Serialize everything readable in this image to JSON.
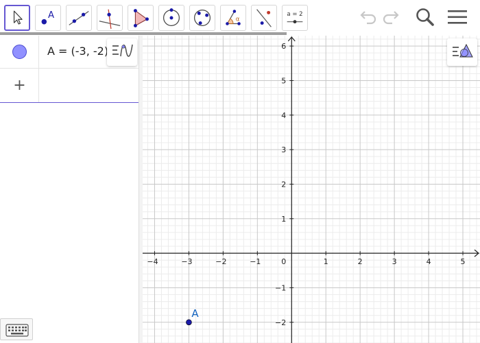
{
  "toolbar": {
    "tools": [
      {
        "name": "move-tool",
        "icon": "cursor-arrow-icon",
        "active": true
      },
      {
        "name": "point-tool",
        "icon": "point-icon",
        "label": "A"
      },
      {
        "name": "line-tool",
        "icon": "line-through-points-icon"
      },
      {
        "name": "perpendicular-line-tool",
        "icon": "perpendicular-line-icon"
      },
      {
        "name": "polygon-tool",
        "icon": "polygon-icon"
      },
      {
        "name": "circle-center-point-tool",
        "icon": "circle-center-icon"
      },
      {
        "name": "circle-three-points-tool",
        "icon": "circle-three-points-icon"
      },
      {
        "name": "angle-tool",
        "icon": "angle-icon",
        "label": "α"
      },
      {
        "name": "reflect-tool",
        "icon": "reflect-about-line-icon"
      },
      {
        "name": "slider-tool",
        "icon": "slider-icon",
        "label": "a = 2"
      }
    ],
    "controls": [
      "undo-icon",
      "redo-icon",
      "search-icon",
      "menu-icon"
    ]
  },
  "algebra": {
    "objects": [
      {
        "definition": "A = (-3, -2)",
        "color": "#9191ff",
        "visible": true
      }
    ],
    "input_row_icon": "+"
  },
  "graphics": {
    "x_range": [
      -4.35,
      5.5
    ],
    "y_range": [
      -2.6,
      6.3
    ],
    "x_ticks": [
      "−4",
      "−3",
      "−2",
      "−1",
      "1",
      "2",
      "3",
      "4",
      "5"
    ],
    "y_ticks": [
      "6",
      "5",
      "4",
      "3",
      "2",
      "1",
      "−1",
      "−2"
    ],
    "origin_label": "0",
    "point": {
      "label": "A",
      "x": -3,
      "y": -2,
      "color": "#1565c0"
    },
    "grid": true
  },
  "colors": {
    "accent": "#6557d2",
    "point": "#1a1aa8",
    "point_label": "#1565c0"
  }
}
